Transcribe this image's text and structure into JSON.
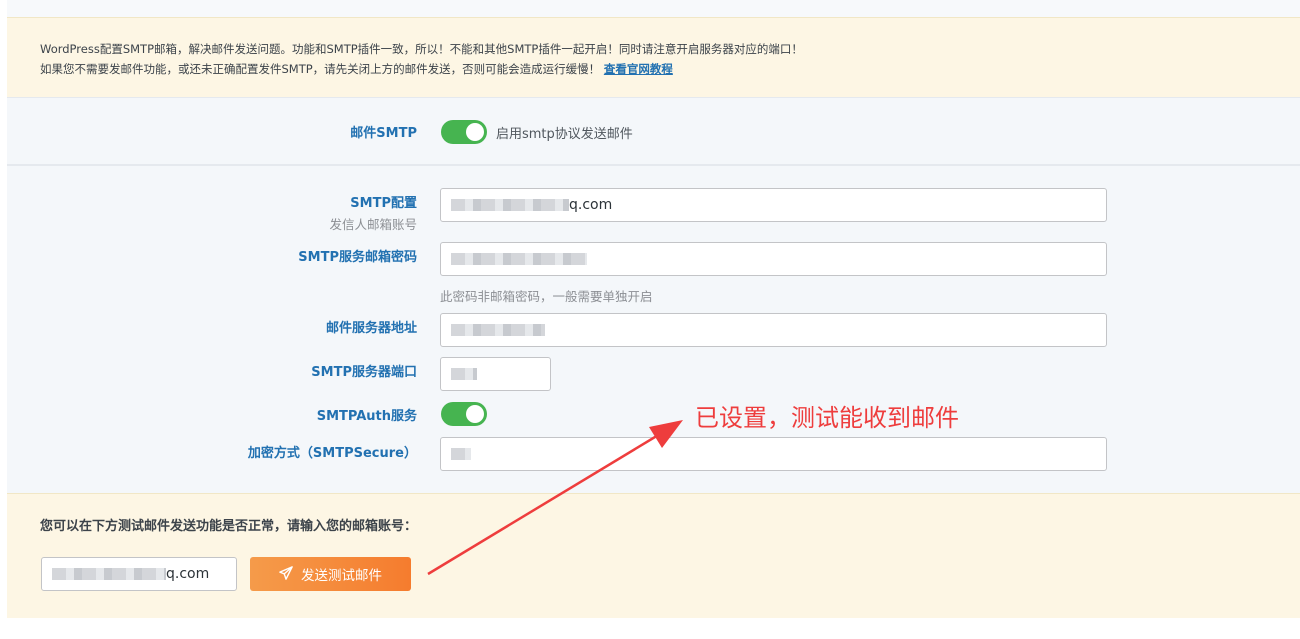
{
  "notice": {
    "line1": "WordPress配置SMTP邮箱，解决邮件发送问题。功能和SMTP插件一致，所以！不能和其他SMTP插件一起开启！同时请注意开启服务器对应的端口！",
    "line2": "如果您不需要发邮件功能，或还未正确配置发件SMTP，请先关闭上方的邮件发送，否则可能会造成运行缓慢！",
    "link": "查看官网教程"
  },
  "smtp": {
    "label": "邮件SMTP",
    "toggle_on": true,
    "toggle_text": "启用smtp协议发送邮件"
  },
  "config": {
    "label": "SMTP配置",
    "sublabel": "发信人邮箱账号",
    "sender_value_suffix": "q.com",
    "password_label": "SMTP服务邮箱密码",
    "password_hint": "此密码非邮箱密码，一般需要单独开启",
    "host_label": "邮件服务器地址",
    "port_label": "SMTP服务器端口",
    "auth_label": "SMTPAuth服务",
    "auth_on": true,
    "secure_label": "加密方式（SMTPSecure）"
  },
  "test": {
    "title": "您可以在下方测试邮件发送功能是否正常，请输入您的邮箱账号：",
    "email_value_suffix": "q.com",
    "button_label": "发送测试邮件",
    "button_icon": "paper-plane-icon"
  },
  "annotation": {
    "text": "已设置，测试能收到邮件",
    "color": "#ee3d3d"
  },
  "colors": {
    "accent": "#2271b1",
    "toggle": "#46b450",
    "button": "#f57c2e"
  }
}
